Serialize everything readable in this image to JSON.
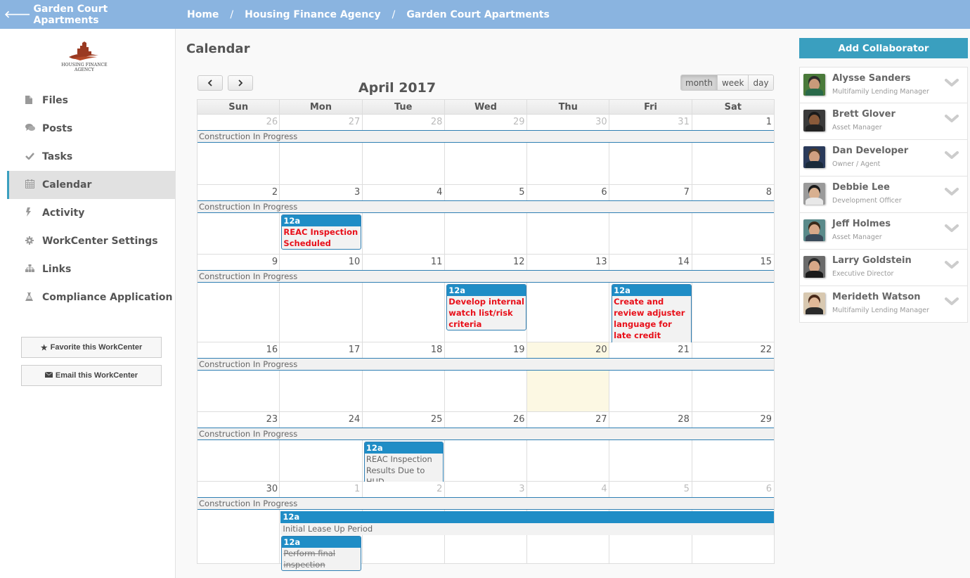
{
  "header": {
    "back_label": "Garden Court Apartments",
    "breadcrumb": [
      "Home",
      "Housing Finance Agency",
      "Garden Court Apartments"
    ],
    "separator": "/"
  },
  "sidebar": {
    "logo_text_line1": "HOUSING FINANCE",
    "logo_text_line2": "AGENCY",
    "items": [
      {
        "label": "Files",
        "icon": "file-icon",
        "glyph": "▮"
      },
      {
        "label": "Posts",
        "icon": "comments-icon",
        "glyph": "💬"
      },
      {
        "label": "Tasks",
        "icon": "check-icon",
        "glyph": "✔"
      },
      {
        "label": "Calendar",
        "icon": "calendar-icon",
        "glyph": "▦",
        "active": true
      },
      {
        "label": "Activity",
        "icon": "bolt-icon",
        "glyph": "ϟ"
      },
      {
        "label": "WorkCenter Settings",
        "icon": "gear-icon",
        "glyph": "⚙"
      },
      {
        "label": "Links",
        "icon": "sitemap-icon",
        "glyph": "⊥"
      },
      {
        "label": "Compliance Application",
        "icon": "flask-icon",
        "glyph": "⚗"
      }
    ],
    "favorite_label": "Favorite this WorkCenter",
    "email_label": "Email this WorkCenter"
  },
  "main": {
    "title": "Calendar",
    "prev_label": "‹",
    "next_label": "›",
    "month_title": "April 2017",
    "views": [
      {
        "label": "month",
        "active": true
      },
      {
        "label": "week",
        "active": false
      },
      {
        "label": "day",
        "active": false
      }
    ],
    "weekdays": [
      "Sun",
      "Mon",
      "Tue",
      "Wed",
      "Thu",
      "Fri",
      "Sat"
    ],
    "today": "20",
    "weeks": [
      {
        "days": [
          {
            "n": "26",
            "other": true
          },
          {
            "n": "27",
            "other": true
          },
          {
            "n": "28",
            "other": true
          },
          {
            "n": "29",
            "other": true
          },
          {
            "n": "30",
            "other": true
          },
          {
            "n": "31",
            "other": true
          },
          {
            "n": "1"
          }
        ],
        "allday": "Construction In Progress",
        "events": []
      },
      {
        "days": [
          {
            "n": "2"
          },
          {
            "n": "3"
          },
          {
            "n": "4"
          },
          {
            "n": "5"
          },
          {
            "n": "6"
          },
          {
            "n": "7"
          },
          {
            "n": "8"
          }
        ],
        "allday": "Construction In Progress",
        "events": [
          {
            "col": 1,
            "time": "12a",
            "title": "REAC Inspection Scheduled",
            "style": "urgent"
          }
        ]
      },
      {
        "days": [
          {
            "n": "9"
          },
          {
            "n": "10"
          },
          {
            "n": "11"
          },
          {
            "n": "12"
          },
          {
            "n": "13"
          },
          {
            "n": "14"
          },
          {
            "n": "15"
          }
        ],
        "allday": "Construction In Progress",
        "events": [
          {
            "col": 3,
            "time": "12a",
            "title": "Develop internal watch list/risk criteria",
            "style": "urgent"
          },
          {
            "col": 5,
            "time": "12a",
            "title": "Create and review adjuster language for late credit delivery",
            "style": "urgent"
          }
        ]
      },
      {
        "days": [
          {
            "n": "16"
          },
          {
            "n": "17"
          },
          {
            "n": "18"
          },
          {
            "n": "19"
          },
          {
            "n": "20",
            "today": true
          },
          {
            "n": "21"
          },
          {
            "n": "22"
          }
        ],
        "allday": "Construction In Progress",
        "events": []
      },
      {
        "days": [
          {
            "n": "23"
          },
          {
            "n": "24"
          },
          {
            "n": "25"
          },
          {
            "n": "26"
          },
          {
            "n": "27"
          },
          {
            "n": "28"
          },
          {
            "n": "29"
          }
        ],
        "allday": "Construction In Progress",
        "events": [
          {
            "col": 2,
            "time": "12a",
            "title": "REAC Inspection Results Due to HUD",
            "style": "normal"
          }
        ]
      },
      {
        "days": [
          {
            "n": "30"
          },
          {
            "n": "1",
            "other": true
          },
          {
            "n": "2",
            "other": true
          },
          {
            "n": "3",
            "other": true
          },
          {
            "n": "4",
            "other": true
          },
          {
            "n": "5",
            "other": true
          },
          {
            "n": "6",
            "other": true
          }
        ],
        "allday": "Construction In Progress",
        "span_event": {
          "start_col": 1,
          "time": "12a",
          "title": "Initial Lease Up Period"
        },
        "events": [
          {
            "col": 1,
            "time": "12a",
            "title": "Perform final inspection",
            "style": "done"
          }
        ]
      }
    ]
  },
  "collaborators": {
    "add_label": "Add Collaborator",
    "people": [
      {
        "name": "Alysse Sanders",
        "role": "Multifamily Lending Manager",
        "bg": "#4a7a3a",
        "skin": "#c99a7a",
        "hair": "#2b2b2b",
        "shirt": "#2a6a4a"
      },
      {
        "name": "Brett Glover",
        "role": "Asset Manager",
        "bg": "#3a3a3a",
        "skin": "#8a5a3a",
        "hair": "#1a1a1a",
        "shirt": "#222222"
      },
      {
        "name": "Dan Developer",
        "role": "Owner / Agent",
        "bg": "#2a3a5a",
        "skin": "#d0a080",
        "hair": "#4a3a2a",
        "shirt": "#1a2a3a"
      },
      {
        "name": "Debbie Lee",
        "role": "Development Officer",
        "bg": "#9a9a9a",
        "skin": "#d8b090",
        "hair": "#1a1a1a",
        "shirt": "#e8e8e8"
      },
      {
        "name": "Jeff Holmes",
        "role": "Asset Manager",
        "bg": "#5a8a8a",
        "skin": "#d8a888",
        "hair": "#3a2a1a",
        "shirt": "#3a4a5a"
      },
      {
        "name": "Larry Goldstein",
        "role": "Executive Director",
        "bg": "#6a6a6a",
        "skin": "#d8a888",
        "hair": "#2a2a2a",
        "shirt": "#1a1a1a"
      },
      {
        "name": "Merideth Watson",
        "role": "Multifamily Lending Manager",
        "bg": "#d8c8b0",
        "skin": "#e0b898",
        "hair": "#4a2a1a",
        "shirt": "#2a2a2a"
      }
    ]
  }
}
